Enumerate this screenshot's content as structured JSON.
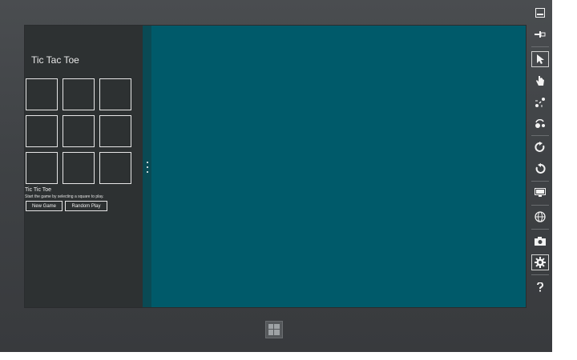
{
  "app": {
    "title": "Tic Tac Toe",
    "game_name": "Tic Tic Toe",
    "hint": "Start the game by selecting a square to play.",
    "new_game_label": "New Game",
    "random_play_label": "Random Play"
  },
  "board": {
    "cells": [
      "",
      "",
      "",
      "",
      "",
      "",
      "",
      "",
      ""
    ]
  },
  "simulator_toolbar": {
    "items": [
      "minimize-icon",
      "pin-icon",
      "mouse-mode-icon",
      "touch-mode-icon",
      "pinch-zoom-icon",
      "rotation-touch-icon",
      "rotate-clockwise-icon",
      "rotate-counterclockwise-icon",
      "change-resolution-icon",
      "set-location-icon",
      "screenshot-icon",
      "settings-icon",
      "help-icon"
    ]
  },
  "colors": {
    "accent_teal": "#005a6a",
    "pane_bg": "#2d3132",
    "bezel": "#404346"
  }
}
